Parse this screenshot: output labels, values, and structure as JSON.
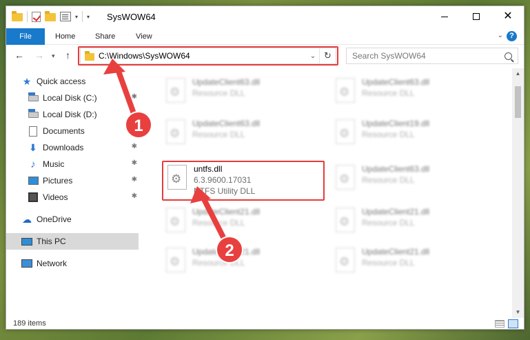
{
  "window": {
    "title": "SysWOW64"
  },
  "ribbon": {
    "tabs": [
      "File",
      "Home",
      "Share",
      "View"
    ],
    "help": "?"
  },
  "address": {
    "path": "C:\\Windows\\SysWOW64"
  },
  "search": {
    "placeholder": "Search SysWOW64"
  },
  "sidebar": {
    "items": [
      {
        "label": "Quick access",
        "icon": "star-icon"
      },
      {
        "label": "Local Disk (C:)",
        "icon": "disk-icon",
        "pinned": true
      },
      {
        "label": "Local Disk (D:)",
        "icon": "disk-icon"
      },
      {
        "label": "Documents",
        "icon": "documents-icon"
      },
      {
        "label": "Downloads",
        "icon": "downloads-icon",
        "pinned": true
      },
      {
        "label": "Music",
        "icon": "music-icon",
        "pinned": true
      },
      {
        "label": "Pictures",
        "icon": "pictures-icon",
        "pinned": true
      },
      {
        "label": "Videos",
        "icon": "videos-icon",
        "pinned": true
      },
      {
        "label": "OneDrive",
        "icon": "onedrive-icon"
      },
      {
        "label": "This PC",
        "icon": "this-pc-icon",
        "selected": true
      },
      {
        "label": "Network",
        "icon": "network-icon"
      }
    ]
  },
  "files": {
    "left": [
      {
        "name": "UpdateClient63.dll",
        "meta1": "Resource DLL"
      },
      {
        "name": "UpdateClient63.dll",
        "meta1": "Resource DLL"
      },
      {
        "name": "untfs.dll",
        "meta1": "6.3.9600.17031",
        "meta2": "NTFS Utility DLL"
      },
      {
        "name": "UpdateClient21.dll",
        "meta1": "Resource DLL"
      },
      {
        "name": "UpdateClient21.dll",
        "meta1": "Resource DLL"
      }
    ],
    "right": [
      {
        "name": "UpdateClient63.dll",
        "meta1": "Resource DLL"
      },
      {
        "name": "UpdateClient19.dll",
        "meta1": "Resource DLL"
      },
      {
        "name": "UpdateClient63.dll",
        "meta1": "Resource DLL"
      },
      {
        "name": "UpdateClient21.dll",
        "meta1": "Resource DLL"
      },
      {
        "name": "UpdateClient21.dll",
        "meta1": "Resource DLL"
      }
    ]
  },
  "status": {
    "count": "189 items"
  },
  "annotations": {
    "step1": "1",
    "step2": "2"
  },
  "colors": {
    "accent": "#1979ca",
    "highlight": "#e83a3a"
  }
}
